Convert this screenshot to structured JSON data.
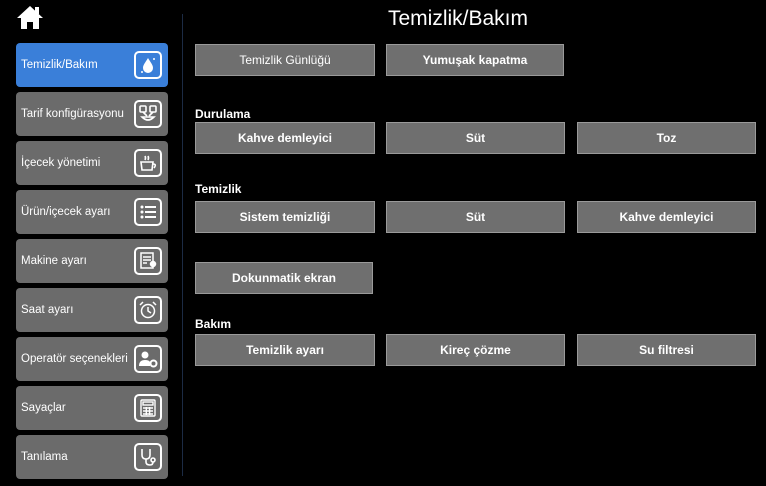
{
  "header": {
    "title": "Temizlik/Bakım"
  },
  "sidebar": {
    "items": [
      {
        "label": "Temizlik/Bakım",
        "icon": "water-drop-icon"
      },
      {
        "label": "Tarif konfigürasyonu",
        "icon": "recipe-icon"
      },
      {
        "label": "İçecek yönetimi",
        "icon": "cup-icon"
      },
      {
        "label": "Ürün/içecek ayarı",
        "icon": "list-icon"
      },
      {
        "label": "Makine ayarı",
        "icon": "machine-icon"
      },
      {
        "label": "Saat ayarı",
        "icon": "alarm-clock-icon"
      },
      {
        "label": "Operatör seçenekleri",
        "icon": "operator-gear-icon"
      },
      {
        "label": "Sayaçlar",
        "icon": "calculator-icon"
      },
      {
        "label": "Tanılama",
        "icon": "stethoscope-icon"
      }
    ]
  },
  "top_buttons": {
    "log": "Temizlik Günlüğü",
    "soft_off": "Yumuşak kapatma"
  },
  "rinse": {
    "title": "Durulama",
    "brewer": "Kahve demleyici",
    "milk": "Süt",
    "powder": "Toz"
  },
  "cleaning": {
    "title": "Temizlik",
    "system": "Sistem temizliği",
    "milk": "Süt",
    "brewer": "Kahve demleyici",
    "touchscreen": "Dokunmatik ekran"
  },
  "maintenance": {
    "title": "Bakım",
    "settings": "Temizlik ayarı",
    "descale": "Kireç çözme",
    "water_filter": "Su filtresi"
  },
  "colors": {
    "active": "#3a7fd9",
    "item": "#6b6b6b",
    "button": "#6f6f6f"
  }
}
